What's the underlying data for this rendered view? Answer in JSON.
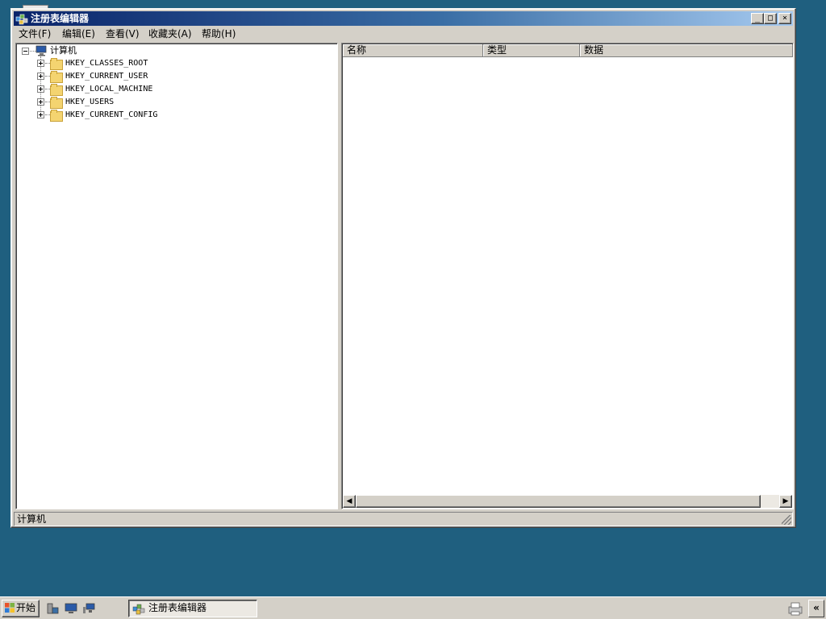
{
  "window": {
    "title": "注册表编辑器",
    "controls": {
      "minimize": "_",
      "maximize": "□",
      "close": "×"
    }
  },
  "menu": [
    {
      "label": "文件(F)"
    },
    {
      "label": "编辑(E)"
    },
    {
      "label": "查看(V)"
    },
    {
      "label": "收藏夹(A)"
    },
    {
      "label": "帮助(H)"
    }
  ],
  "tree": {
    "root": "计算机",
    "children": [
      {
        "label": "HKEY_CLASSES_ROOT"
      },
      {
        "label": "HKEY_CURRENT_USER"
      },
      {
        "label": "HKEY_LOCAL_MACHINE"
      },
      {
        "label": "HKEY_USERS"
      },
      {
        "label": "HKEY_CURRENT_CONFIG"
      }
    ]
  },
  "list": {
    "columns": [
      "名称",
      "类型",
      "数据"
    ]
  },
  "statusbar": {
    "text": "计算机"
  },
  "taskbar": {
    "start_label": "开始",
    "task_label": "注册表编辑器",
    "chevron": "«"
  },
  "icons": {
    "app": "regedit-icon",
    "computer": "computer-icon",
    "folder": "folder-icon",
    "start_logo": "windows-logo-icon",
    "quicklaunch": [
      "server-manager-icon",
      "desktop-icon",
      "network-icon"
    ],
    "tray": "printer-icon"
  }
}
